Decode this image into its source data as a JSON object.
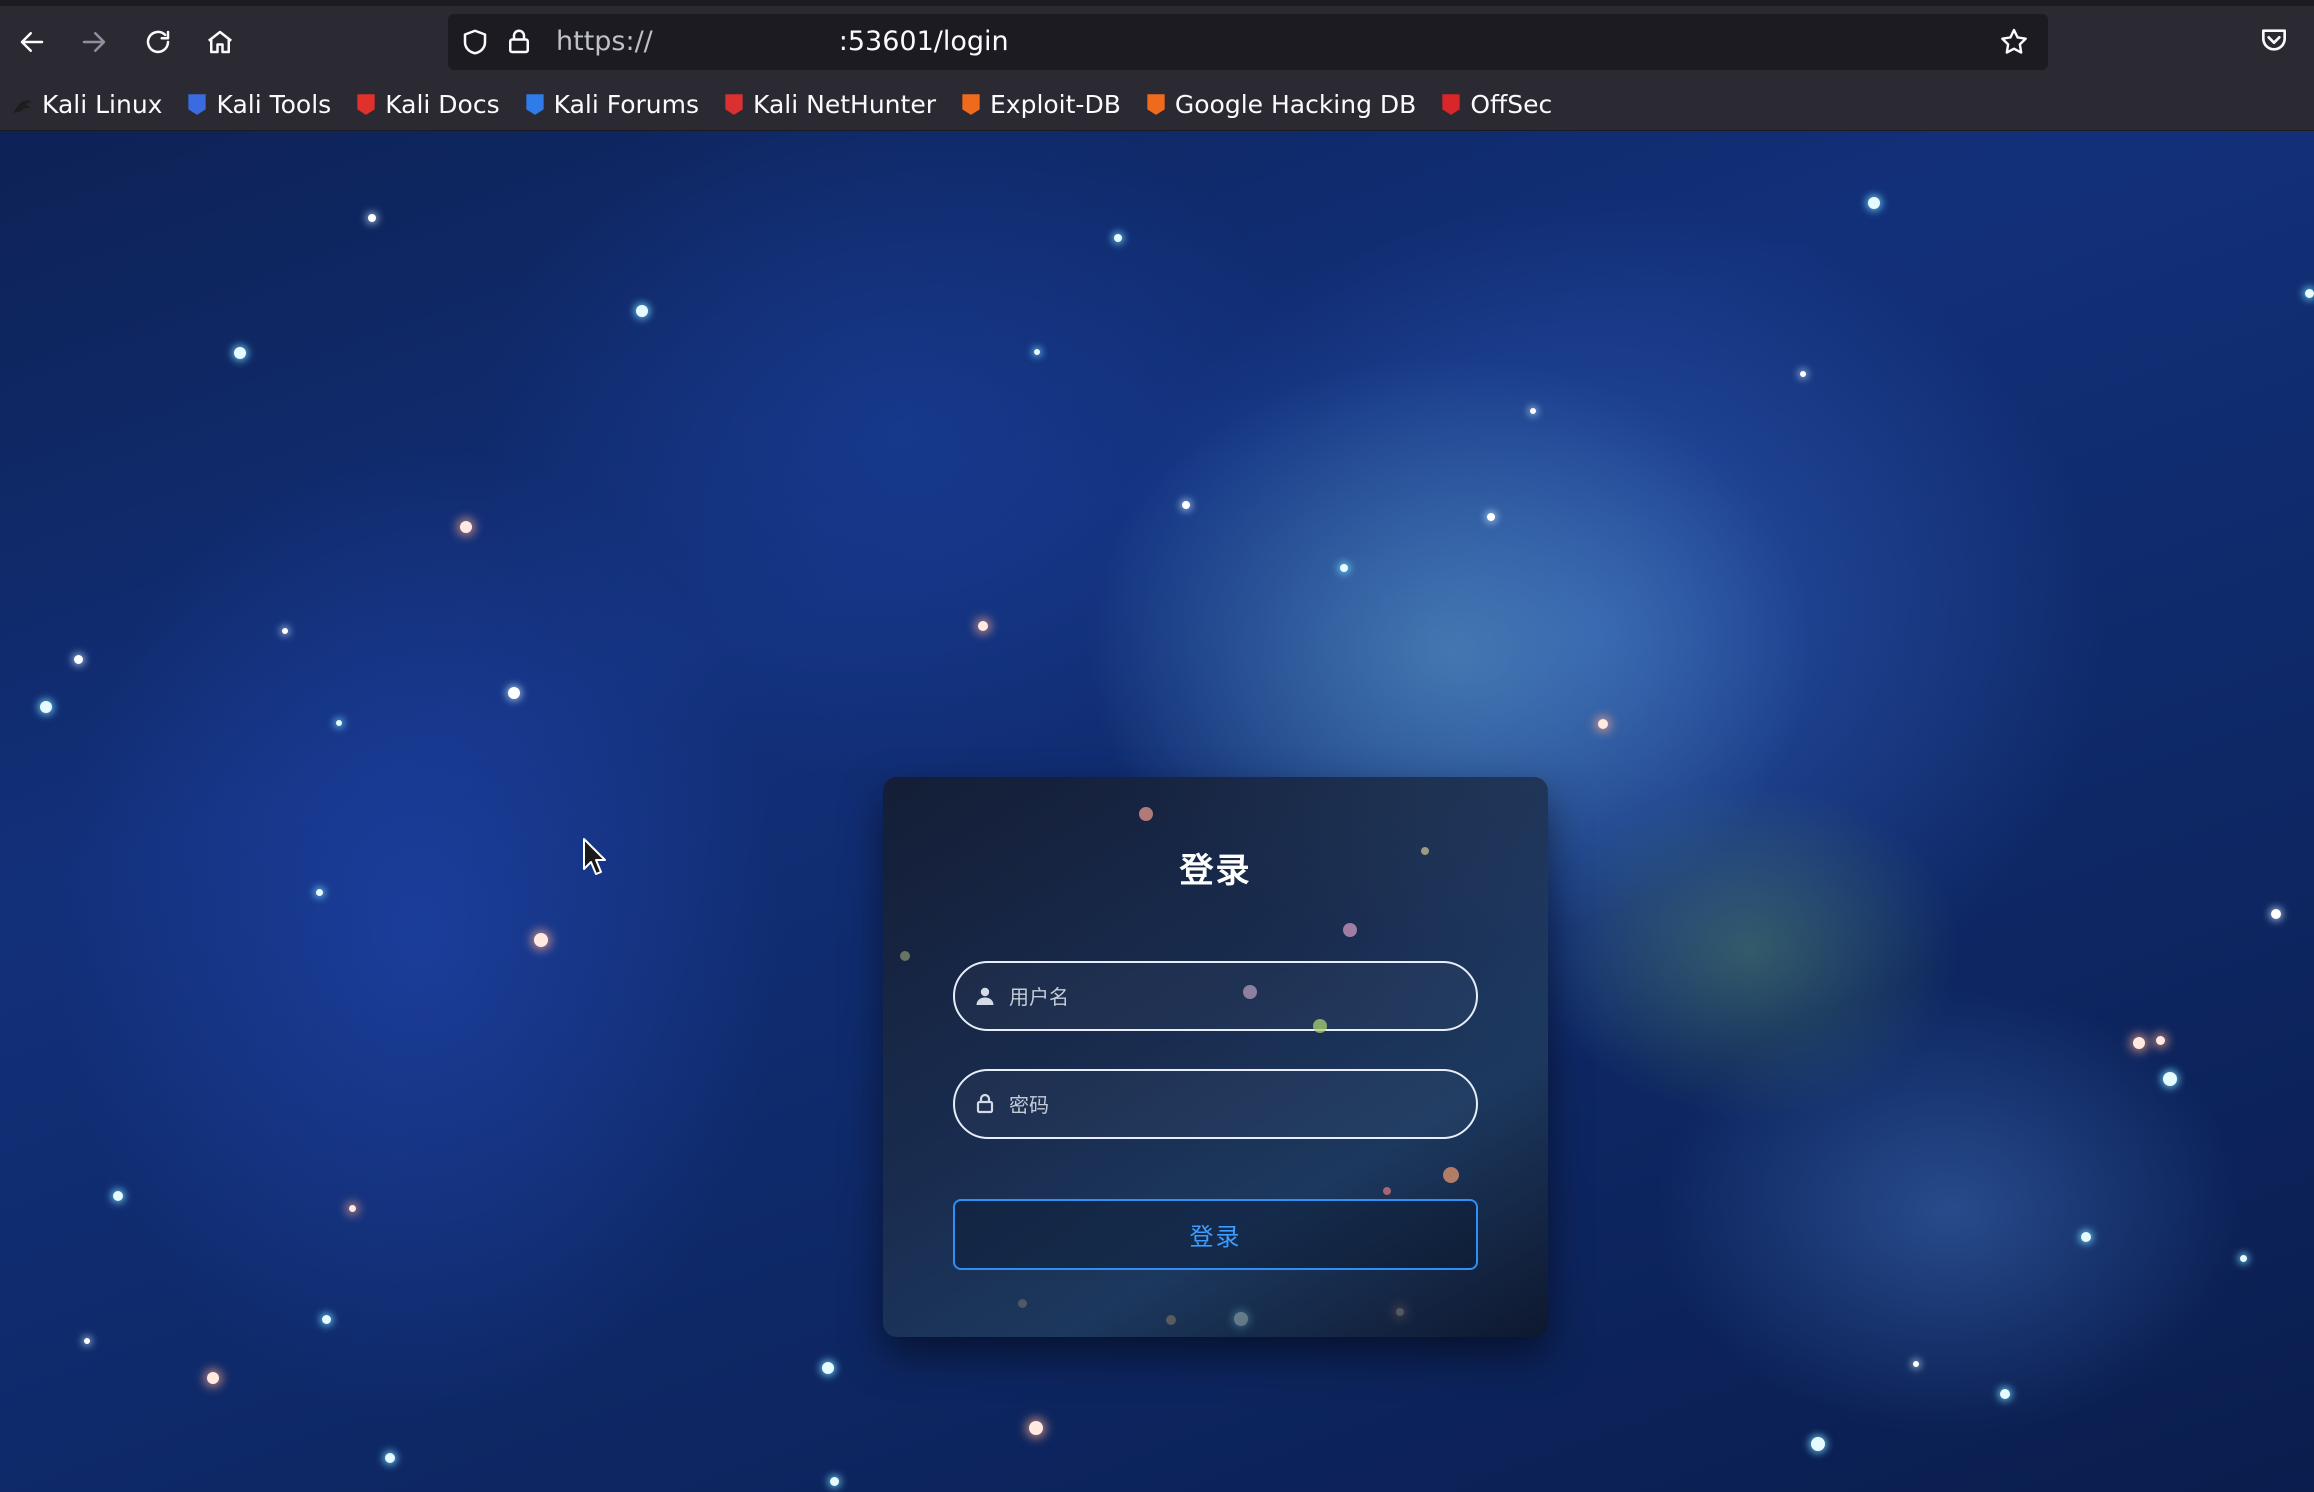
{
  "browser": {
    "url_scheme": "https://",
    "url_rest": ":53601/login",
    "nav": {
      "back_icon": "arrow-left-icon",
      "forward_icon": "arrow-right-icon",
      "reload_icon": "reload-icon",
      "home_icon": "home-icon"
    },
    "bookmarks": [
      {
        "label": "Kali Linux",
        "icon": "kali-dragon-icon",
        "color": "#1d1d1d"
      },
      {
        "label": "Kali Tools",
        "icon": "kali-tools-icon",
        "color": "#3a6be0"
      },
      {
        "label": "Kali Docs",
        "icon": "kali-docs-icon",
        "color": "#e0312c"
      },
      {
        "label": "Kali Forums",
        "icon": "kali-forums-icon",
        "color": "#2f7be8"
      },
      {
        "label": "Kali NetHunter",
        "icon": "kali-nethunter-icon",
        "color": "#d9312f"
      },
      {
        "label": "Exploit-DB",
        "icon": "exploit-db-icon",
        "color": "#ef6a1c"
      },
      {
        "label": "Google Hacking DB",
        "icon": "ghdb-icon",
        "color": "#ef6a1c"
      },
      {
        "label": "OffSec",
        "icon": "offsec-icon",
        "color": "#d8262a"
      }
    ]
  },
  "login": {
    "title": "登录",
    "username_placeholder": "用户名",
    "password_placeholder": "密码",
    "submit_label": "登录"
  },
  "colors": {
    "accent": "#2f8ff5",
    "chrome_bg": "#2b2a33",
    "urlbar_bg": "#1c1b22"
  }
}
